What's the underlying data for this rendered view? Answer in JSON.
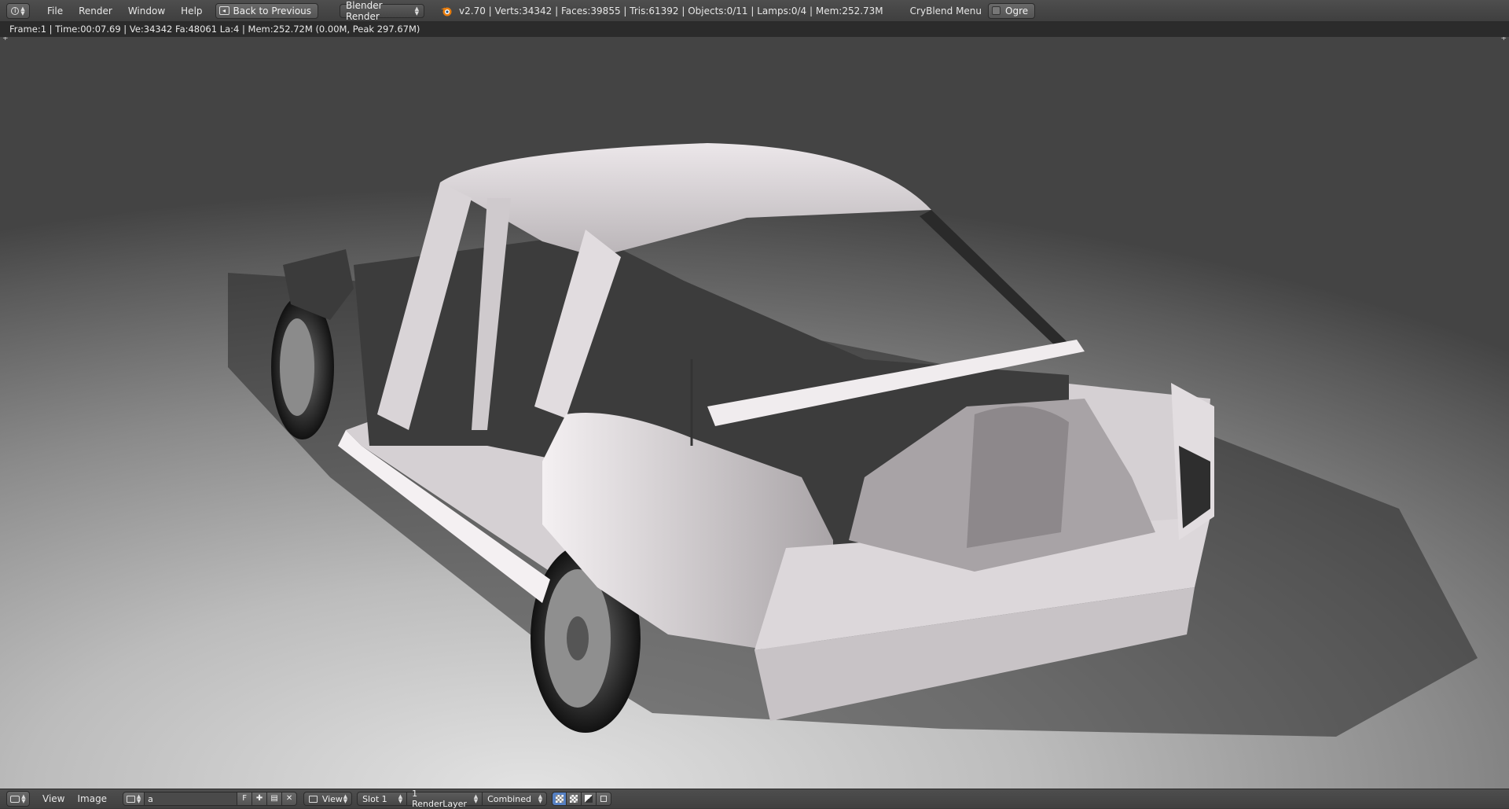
{
  "top_header": {
    "menus": [
      "File",
      "Render",
      "Window",
      "Help"
    ],
    "back_button": "Back to Previous",
    "render_engine": "Blender Render",
    "stats": "v2.70 | Verts:34342 | Faces:39855 | Tris:61392 | Objects:0/11 | Lamps:0/4 | Mem:252.73M",
    "addon_menu": "CryBlend Menu",
    "ogre_label": "Ogre"
  },
  "render_status": "Frame:1 | Time:00:07.69 | Ve:34342 Fa:48061 La:4 | Mem:252.72M (0.00M, Peak 297.67M)",
  "bottom_header": {
    "menus": [
      "View",
      "Image"
    ],
    "image_name": "a",
    "fake_user": "F",
    "view_mode": "View",
    "slot": "Slot 1",
    "render_layer": "1 RenderLayer",
    "pass": "Combined"
  },
  "colors": {
    "header": "#454545",
    "status_bg": "#2b2b2b",
    "active_toggle": "#5680c2",
    "car_body": "#e9e4e7"
  },
  "icons": [
    "info-icon",
    "back-icon",
    "blender-logo-icon",
    "image-editor-icon",
    "image-browse-icon",
    "add-image-icon",
    "open-image-icon",
    "close-image-icon",
    "draw-channels-icon"
  ]
}
